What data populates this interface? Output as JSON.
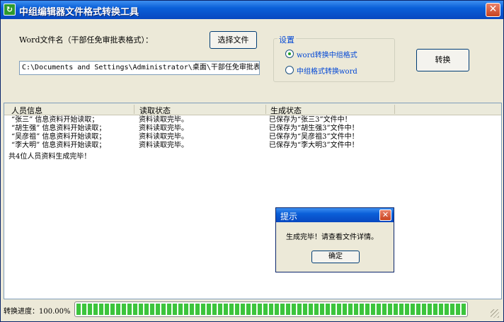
{
  "window": {
    "title": "中组编辑器文件格式转换工具",
    "close_glyph": "✕"
  },
  "top": {
    "word_label": "Word文件名（干部任免审批表格式）：",
    "choose_button": "选择文件",
    "path_value": "C:\\Documents and Settings\\Administrator\\桌面\\干部任免审批表",
    "settings_legend": "设置",
    "options": [
      {
        "label": "word转换中组格式",
        "selected": true
      },
      {
        "label": "中组格式转换word",
        "selected": false
      }
    ],
    "convert_button": "转换"
  },
  "list": {
    "columns": [
      "人员信息",
      "读取状态",
      "生成状态"
    ],
    "rows": [
      [
        "“张三” 信息资料开始读取；",
        "资料读取完毕。",
        "已保存为“张三3”文件中！"
      ],
      [
        "“胡生强” 信息资料开始读取；",
        "资料读取完毕。",
        "已保存为“胡生强3”文件中！"
      ],
      [
        "“吴彦祖” 信息资料开始读取；",
        "资料读取完毕。",
        "已保存为“吴彦祖3”文件中！"
      ],
      [
        "“李大明” 信息资料开始读取；",
        "资料读取完毕。",
        "已保存为“李大明3”文件中！"
      ]
    ],
    "summary": "共4位人员资料生成完毕！"
  },
  "dialog": {
    "title": "提示",
    "message": "生成完毕！请查看文件详情。",
    "ok_button": "确定",
    "close_glyph": "✕"
  },
  "status": {
    "progress_label": "转换进度：100.00%",
    "progress_percent": 100
  },
  "icons": {
    "app": "app-refresh-icon"
  },
  "colors": {
    "titlebar": "#0a5fd8",
    "progress": "#3cc43c",
    "accent_text": "#0046d5"
  }
}
